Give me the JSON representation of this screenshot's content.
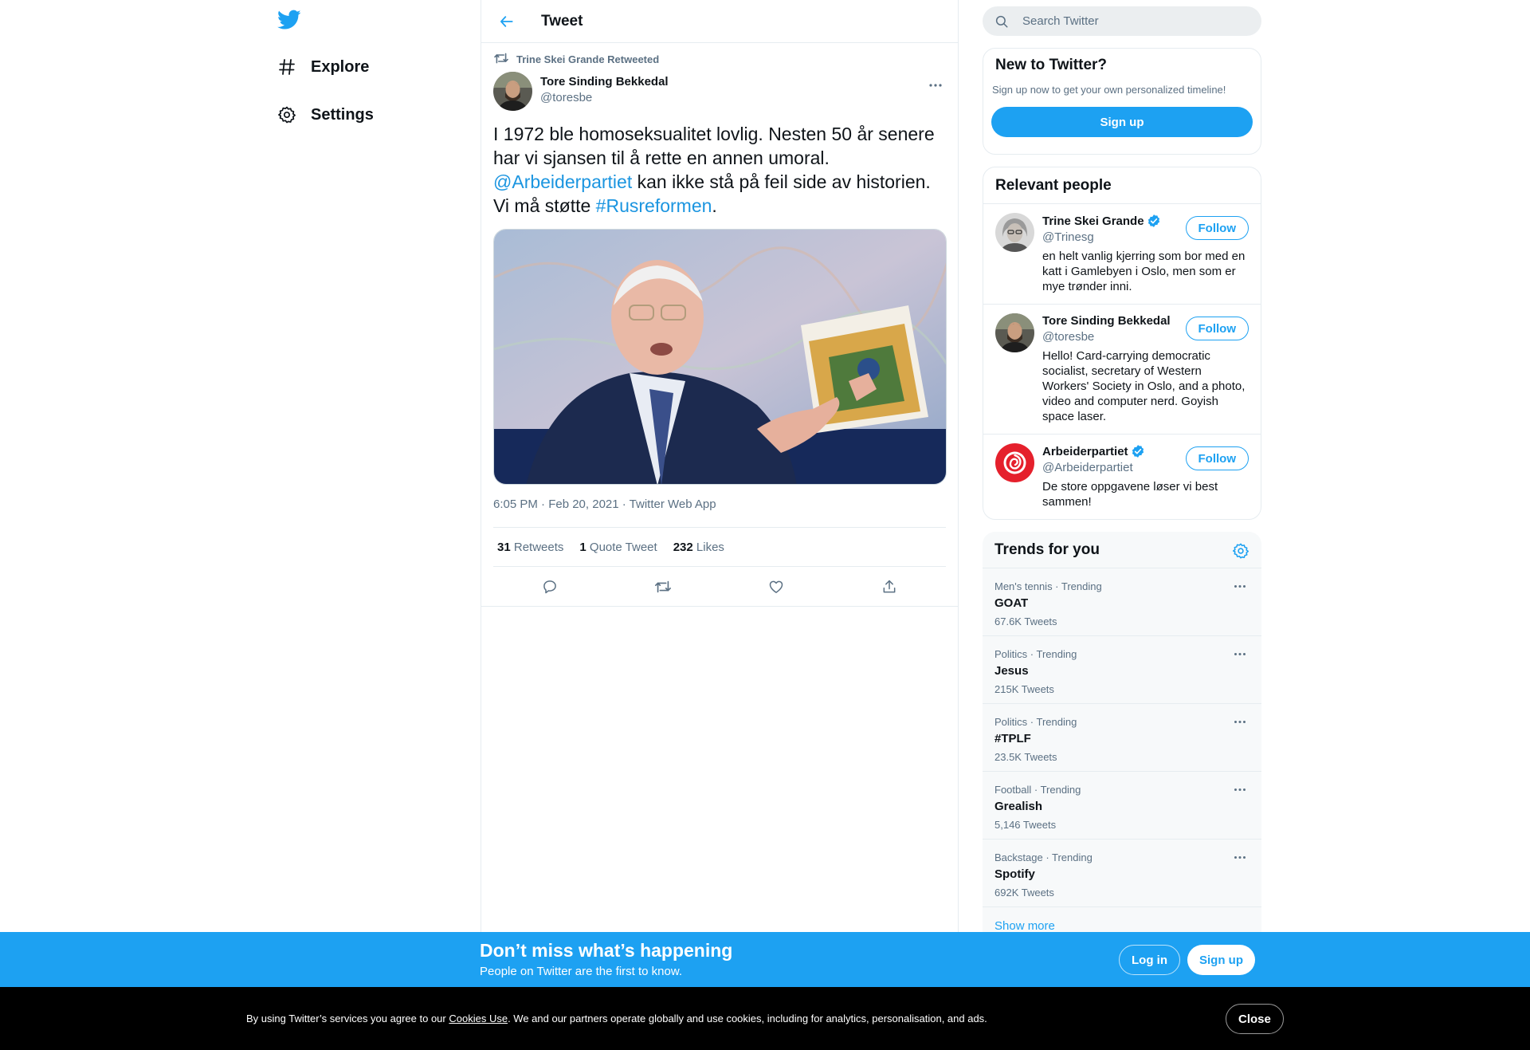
{
  "colors": {
    "accent": "#1da1f2",
    "link": "#1b95e0",
    "secondary_text": "#5b7083",
    "border": "#e6ecf0",
    "cookie_bg": "#000000"
  },
  "nav": {
    "logo_icon": "twitter-bird-icon",
    "items": [
      {
        "label": "Explore",
        "icon": "hashtag-icon"
      },
      {
        "label": "Settings",
        "icon": "gear-icon"
      }
    ]
  },
  "header": {
    "title": "Tweet",
    "back_icon": "arrow-left-icon"
  },
  "tweet": {
    "retweeted_by": "Trine Skei Grande Retweeted",
    "author_name": "Tore Sinding Bekkedal",
    "author_handle": "@toresbe",
    "text_part1": "I 1972 ble homoseksualitet lovlig. Nesten 50 år senere har vi sjansen til å rette en annen umoral. ",
    "mention": "@Arbeiderpartiet",
    "text_part2": " kan ikke stå på feil side av historien. Vi må støtte ",
    "hashtag": "#Rusreformen",
    "text_part3": ".",
    "meta": "6:05 PM · Feb 20, 2021 · Twitter Web App",
    "stats": [
      {
        "count": "31",
        "label": "Retweets"
      },
      {
        "count": "1",
        "label": "Quote Tweet"
      },
      {
        "count": "232",
        "label": "Likes"
      }
    ],
    "actions": [
      "reply-icon",
      "retweet-icon",
      "like-icon",
      "share-icon"
    ]
  },
  "search": {
    "placeholder": "Search Twitter"
  },
  "new_to_twitter": {
    "title": "New to Twitter?",
    "subtitle": "Sign up now to get your own personalized timeline!",
    "button": "Sign up"
  },
  "relevant_people": {
    "title": "Relevant people",
    "people": [
      {
        "name": "Trine Skei Grande",
        "verified": true,
        "handle": "@Trinesg",
        "bio": "en helt vanlig kjerring som bor med en katt i Gamlebyen i Oslo, men som er mye trønder inni.",
        "follow": "Follow"
      },
      {
        "name": "Tore Sinding Bekkedal",
        "verified": false,
        "handle": "@toresbe",
        "bio": "Hello! Card-carrying democratic socialist, secretary of Western Workers' Society in Oslo, and a photo, video and computer nerd. Goyish space laser.",
        "follow": "Follow"
      },
      {
        "name": "Arbeiderpartiet",
        "verified": true,
        "handle": "@Arbeiderpartiet",
        "bio": "De store oppgavene løser vi best sammen!",
        "follow": "Follow"
      }
    ]
  },
  "trends": {
    "title": "Trends for you",
    "items": [
      {
        "meta": "Men's tennis · Trending",
        "name": "GOAT",
        "count": "67.6K Tweets"
      },
      {
        "meta": "Politics · Trending",
        "name": "Jesus",
        "count": "215K Tweets"
      },
      {
        "meta": "Politics · Trending",
        "name": "#TPLF",
        "count": "23.5K Tweets"
      },
      {
        "meta": "Football · Trending",
        "name": "Grealish",
        "count": "5,146 Tweets"
      },
      {
        "meta": "Backstage · Trending",
        "name": "Spotify",
        "count": "692K Tweets"
      }
    ],
    "show_more": "Show more"
  },
  "bottom_bar": {
    "title": "Don’t miss what’s happening",
    "subtitle": "People on Twitter are the first to know.",
    "login": "Log in",
    "signup": "Sign up"
  },
  "cookie": {
    "text_before": "By using Twitter’s services you agree to our ",
    "link": "Cookies Use",
    "text_after": ". We and our partners operate globally and use cookies, including for analytics, personalisation, and ads.",
    "close": "Close"
  }
}
